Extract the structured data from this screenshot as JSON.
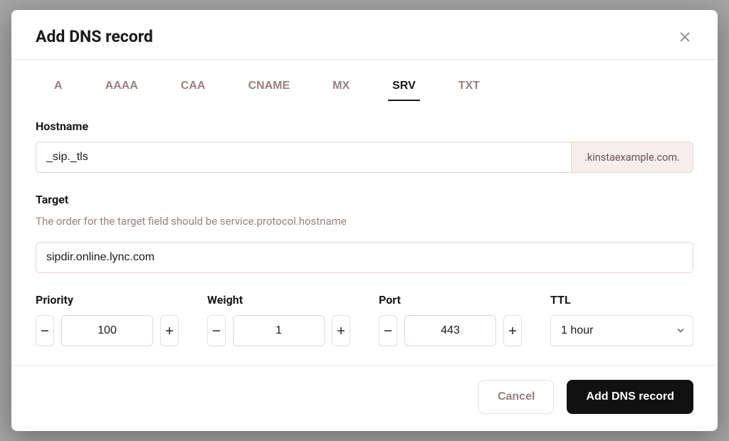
{
  "modal": {
    "title": "Add DNS record"
  },
  "tabs": {
    "items": [
      {
        "label": "A"
      },
      {
        "label": "AAAA"
      },
      {
        "label": "CAA"
      },
      {
        "label": "CNAME"
      },
      {
        "label": "MX"
      },
      {
        "label": "SRV"
      },
      {
        "label": "TXT"
      }
    ],
    "active_index": 5
  },
  "hostname": {
    "label": "Hostname",
    "value": "_sip._tls",
    "suffix": ".kinstaexample.com."
  },
  "target": {
    "label": "Target",
    "help": "The order for the target field should be service.protocol.hostname",
    "value": "sipdir.online.lync.com"
  },
  "priority": {
    "label": "Priority",
    "value": "100"
  },
  "weight": {
    "label": "Weight",
    "value": "1"
  },
  "port": {
    "label": "Port",
    "value": "443"
  },
  "ttl": {
    "label": "TTL",
    "selected": "1 hour"
  },
  "footer": {
    "cancel": "Cancel",
    "submit": "Add DNS record"
  }
}
